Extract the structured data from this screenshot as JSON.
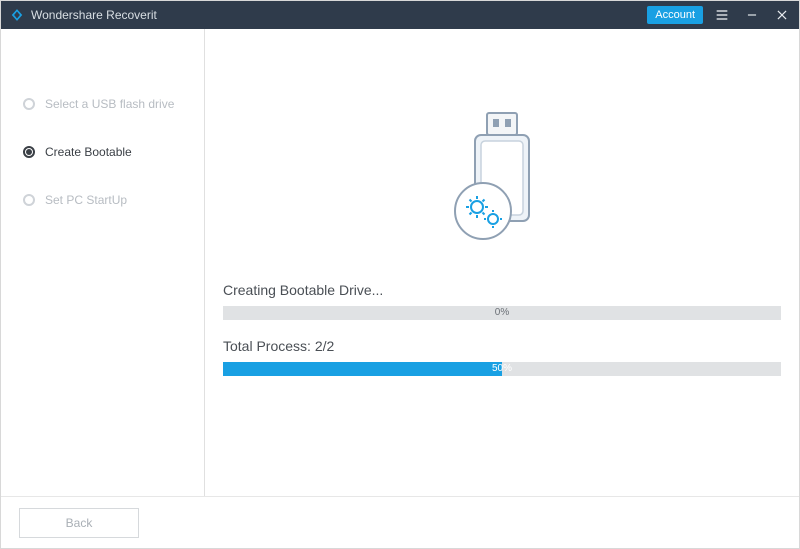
{
  "titlebar": {
    "app_name": "Wondershare Recoverit",
    "account_label": "Account"
  },
  "sidebar": {
    "steps": [
      {
        "label": "Select a USB flash drive",
        "active": false
      },
      {
        "label": "Create Bootable",
        "active": true
      },
      {
        "label": "Set PC StartUp",
        "active": false
      }
    ]
  },
  "main": {
    "progress1": {
      "label": "Creating Bootable Drive...",
      "percent": 0,
      "percent_text": "0%"
    },
    "progress2": {
      "label": "Total Process: 2/2",
      "percent": 50,
      "percent_text": "50%"
    }
  },
  "footer": {
    "back_label": "Back"
  },
  "colors": {
    "accent": "#19a0e3",
    "titlebar_bg": "#2f3b4b"
  }
}
